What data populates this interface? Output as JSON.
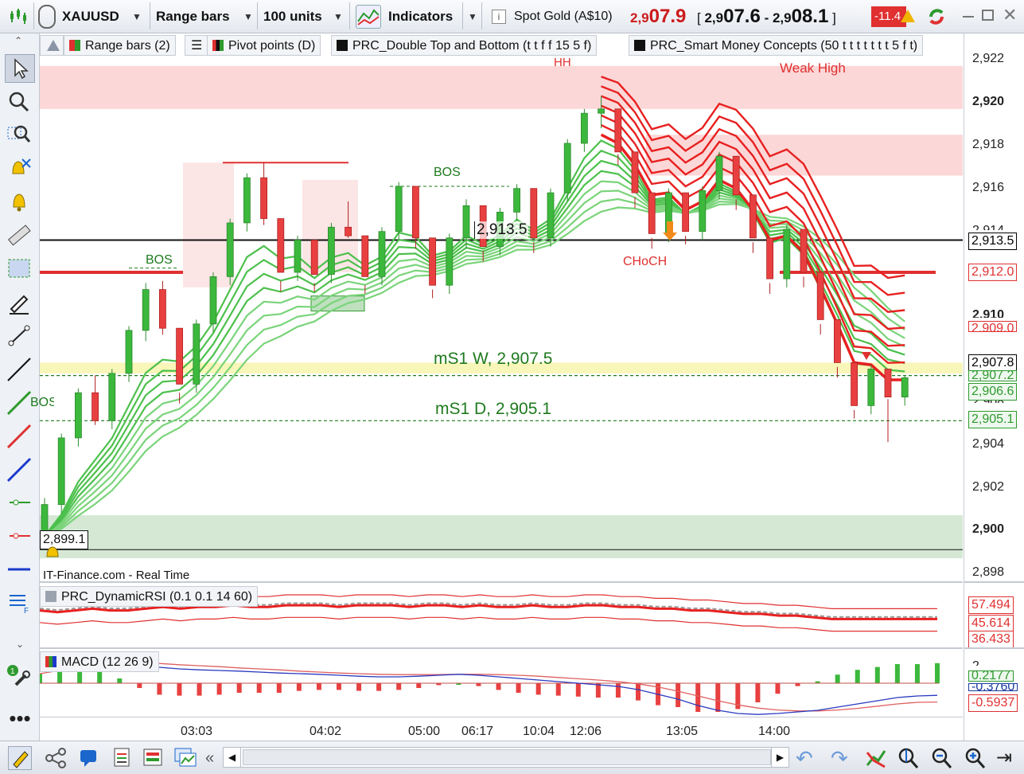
{
  "toolbar": {
    "symbol": "XAUUSD",
    "bar_type": "Range bars",
    "units": "100 units",
    "indicators_label": "Indicators",
    "instrument_name": "Spot Gold (A$10)",
    "last_prefix": "2,9",
    "last_main": "07.9",
    "bid_prefix": "2,9",
    "bid_main": "07.6",
    "ask_prefix": "2,9",
    "ask_main": "08.1",
    "bracket_open": "[",
    "bracket_close": "]",
    "dash": "-",
    "change": "-11.4",
    "colors": {
      "up": "#2e9a2e",
      "down": "#e03030",
      "accent": "#1a66cc"
    }
  },
  "legend_main": [
    {
      "label": "Range bars (2)",
      "icon": "range-bars-icon"
    },
    {
      "label": "Pivot points (D)",
      "icon": "pivot-icon"
    },
    {
      "label": "PRC_Double Top and Bottom (t t f f 15 5 f)",
      "icon": "black-square-icon"
    },
    {
      "label": "PRC_Smart Money Concepts (50 t t t t t t t 5 f t)",
      "icon": "black-square-icon"
    }
  ],
  "annotations": {
    "hh": "HH",
    "weak_high": "Weak High",
    "bos1": "BOS",
    "bos2": "BOS",
    "bos3": "BOS",
    "choch": "CHoCH",
    "ms1w": "mS1 W, 2,907.5",
    "ms1d": "mS1 D, 2,905.1",
    "level_2913": "2,913.5",
    "level_2899": "2,899.1",
    "source": "IT-Finance.com - Real Time"
  },
  "price_axis": {
    "ticks": [
      "2,922",
      "2,920",
      "2,918",
      "2,916",
      "2,914",
      "2,910",
      "2,908",
      "2,906",
      "2,904",
      "2,902",
      "2,900",
      "2,898"
    ],
    "boxes": [
      {
        "label": "2,913.5",
        "color": "#000000"
      },
      {
        "label": "2,912.0",
        "color": "#e03030"
      },
      {
        "label": "2,909.0",
        "color": "#e03030"
      },
      {
        "label": "2,907.8",
        "color": "#000000"
      },
      {
        "label": "2,907.2",
        "color": "#2e9a2e"
      },
      {
        "label": "2,906.6",
        "color": "#2e9a2e"
      },
      {
        "label": "2,905.1",
        "color": "#2e9a2e"
      }
    ]
  },
  "rsi_panel": {
    "legend": "PRC_DynamicRSI (0.1 0.1 14 60)",
    "ticks": [
      {
        "label": "57.494",
        "color": "#e03030"
      },
      {
        "label": "45.614",
        "color": "#e03030"
      },
      {
        "label": "36.433",
        "color": "#e03030"
      }
    ]
  },
  "macd_panel": {
    "legend": "MACD (12 26 9)",
    "ticks": [
      {
        "label": "0.2177",
        "color": "#2e9a2e"
      },
      {
        "label": "-0.3760",
        "color": "#1a3aa0"
      },
      {
        "label": "-0.5937",
        "color": "#e03030"
      },
      {
        "label": "2",
        "color": "#222222"
      }
    ]
  },
  "time_axis": [
    "03:03",
    "04:02",
    "05:00",
    "06:17",
    "10:04",
    "12:06",
    "13:05",
    "14:00"
  ],
  "chart_data": {
    "type": "candlestick",
    "title": "XAUUSD Range bars",
    "ylim": [
      2897.5,
      2922.5
    ],
    "candle_ohlc": [
      [
        2899.5,
        2901.5,
        2899.1,
        2901.2
      ],
      [
        2901.2,
        2904.5,
        2900.8,
        2904.3
      ],
      [
        2904.3,
        2906.6,
        2903.9,
        2906.4
      ],
      [
        2906.4,
        2907.2,
        2904.9,
        2905.1
      ],
      [
        2905.1,
        2907.5,
        2904.7,
        2907.3
      ],
      [
        2907.3,
        2909.5,
        2906.9,
        2909.3
      ],
      [
        2909.3,
        2911.5,
        2908.8,
        2911.2
      ],
      [
        2911.2,
        2911.6,
        2909.1,
        2909.4
      ],
      [
        2909.4,
        2906.4,
        2905.9,
        2906.8
      ],
      [
        2906.8,
        2909.8,
        2906.4,
        2909.6
      ],
      [
        2909.6,
        2912.0,
        2909.2,
        2911.8
      ],
      [
        2911.8,
        2914.5,
        2911.4,
        2914.3
      ],
      [
        2914.3,
        2916.6,
        2913.9,
        2916.4
      ],
      [
        2916.4,
        2917.1,
        2914.2,
        2914.5
      ],
      [
        2914.5,
        2911.6,
        2911.1,
        2912.0
      ],
      [
        2912.0,
        2913.7,
        2911.6,
        2913.5
      ],
      [
        2913.5,
        2911.5,
        2911.1,
        2911.9
      ],
      [
        2911.9,
        2914.3,
        2911.5,
        2914.1
      ],
      [
        2914.1,
        2915.3,
        2913.6,
        2913.7
      ],
      [
        2913.7,
        2911.4,
        2911.0,
        2911.8
      ],
      [
        2911.8,
        2914.1,
        2911.4,
        2913.9
      ],
      [
        2913.9,
        2916.2,
        2913.5,
        2916.0
      ],
      [
        2916.0,
        2913.6,
        2913.1,
        2913.6
      ],
      [
        2913.6,
        2911.2,
        2910.8,
        2911.4
      ],
      [
        2911.4,
        2913.8,
        2911.0,
        2913.6
      ],
      [
        2913.6,
        2915.4,
        2913.1,
        2915.1
      ],
      [
        2915.1,
        2913.0,
        2912.5,
        2913.2
      ],
      [
        2913.2,
        2915.0,
        2912.8,
        2914.8
      ],
      [
        2914.8,
        2916.1,
        2914.4,
        2915.9
      ],
      [
        2915.9,
        2913.4,
        2912.9,
        2913.6
      ],
      [
        2913.6,
        2915.9,
        2913.2,
        2915.7
      ],
      [
        2915.7,
        2918.2,
        2915.3,
        2918.0
      ],
      [
        2918.0,
        2919.6,
        2917.6,
        2919.4
      ],
      [
        2919.4,
        2920.2,
        2918.7,
        2919.6
      ],
      [
        2919.6,
        2917.5,
        2917.0,
        2917.6
      ],
      [
        2917.6,
        2915.5,
        2915.0,
        2915.7
      ],
      [
        2915.7,
        2913.6,
        2913.1,
        2913.8
      ],
      [
        2913.8,
        2915.9,
        2913.4,
        2915.7
      ],
      [
        2915.7,
        2913.7,
        2913.3,
        2913.9
      ],
      [
        2913.9,
        2916.0,
        2913.5,
        2915.8
      ],
      [
        2915.8,
        2917.6,
        2915.4,
        2917.4
      ],
      [
        2917.4,
        2915.4,
        2914.9,
        2915.6
      ],
      [
        2915.6,
        2913.4,
        2912.9,
        2913.6
      ],
      [
        2913.6,
        2911.5,
        2911.0,
        2911.7
      ],
      [
        2911.7,
        2914.2,
        2911.3,
        2914.0
      ],
      [
        2914.0,
        2911.8,
        2911.3,
        2912.0
      ],
      [
        2912.0,
        2909.6,
        2909.1,
        2909.8
      ],
      [
        2909.8,
        2907.6,
        2907.1,
        2907.8
      ],
      [
        2907.8,
        2905.6,
        2905.2,
        2905.8
      ],
      [
        2905.8,
        2907.7,
        2905.4,
        2907.5
      ],
      [
        2907.5,
        2906.1,
        2904.1,
        2906.2
      ],
      [
        2906.2,
        2907.2,
        2905.8,
        2907.1
      ]
    ],
    "series": [
      {
        "name": "fast-ema-ribbon",
        "values": [
          2900.5,
          2901.5,
          2903.0,
          2904.0,
          2905.0,
          2906.5,
          2908.0,
          2908.6,
          2908.5,
          2909.2,
          2910.3,
          2911.8,
          2913.3,
          2913.8,
          2913.2,
          2913.3,
          2912.6,
          2913.2,
          2913.4,
          2912.8,
          2913.2,
          2914.3,
          2914.1,
          2913.2,
          2913.4,
          2914.1,
          2913.7,
          2914.1,
          2914.8,
          2914.3,
          2914.8,
          2916.2,
          2917.6,
          2918.4,
          2918.0,
          2917.0,
          2915.6,
          2915.7,
          2914.9,
          2915.3,
          2916.3,
          2915.9,
          2914.9,
          2913.5,
          2913.7,
          2912.9,
          2911.3,
          2909.6,
          2907.8,
          2907.7,
          2907.0,
          2907.0
        ]
      },
      {
        "name": "slow-ema-ribbon",
        "values": [
          2898.6,
          2899.0,
          2899.5,
          2900.0,
          2900.6,
          2901.4,
          2902.3,
          2903.0,
          2903.5,
          2904.1,
          2904.8,
          2905.6,
          2906.5,
          2907.3,
          2907.8,
          2908.3,
          2908.7,
          2909.2,
          2909.6,
          2909.9,
          2910.2,
          2910.6,
          2911.0,
          2911.2,
          2911.4,
          2911.7,
          2911.9,
          2912.1,
          2912.4,
          2912.5,
          2912.7,
          2913.1,
          2913.6,
          2914.0,
          2914.3,
          2914.4,
          2914.4,
          2914.5,
          2914.5,
          2914.6,
          2914.8,
          2914.9,
          2914.8,
          2914.6,
          2914.5,
          2914.2,
          2913.8,
          2913.2,
          2912.4,
          2911.6,
          2910.8,
          2910.1
        ]
      }
    ],
    "rsi": {
      "ylim": [
        30,
        65
      ],
      "values": [
        50,
        49,
        50,
        51,
        50,
        50,
        51,
        52,
        51,
        52,
        52,
        53,
        52,
        52,
        53,
        53,
        53,
        52,
        53,
        53,
        53,
        52,
        53,
        53,
        52,
        53,
        52,
        52,
        53,
        52,
        52,
        53,
        53,
        52,
        52,
        51,
        51,
        50,
        50,
        49,
        48,
        48,
        47,
        47,
        46,
        45,
        45,
        45,
        45,
        45,
        45,
        45
      ],
      "upper": 57.494,
      "mid": 45.614,
      "lower": 36.433
    },
    "macd": {
      "ylim": [
        -1.0,
        1.0
      ],
      "macd": [
        0.4,
        0.55,
        0.7,
        0.75,
        0.7,
        0.6,
        0.5,
        0.45,
        0.42,
        0.4,
        0.38,
        0.35,
        0.32,
        0.3,
        0.28,
        0.25,
        0.22,
        0.2,
        0.2,
        0.22,
        0.25,
        0.28,
        0.25,
        0.2,
        0.15,
        0.1,
        0.05,
        0.0,
        -0.05,
        -0.1,
        -0.2,
        -0.35,
        -0.5,
        -0.7,
        -0.85,
        -0.95,
        -0.98,
        -0.95,
        -0.9,
        -0.85,
        -0.75,
        -0.65,
        -0.55,
        -0.45,
        -0.4,
        -0.38
      ],
      "signal": [
        0.3,
        0.4,
        0.5,
        0.6,
        0.65,
        0.65,
        0.62,
        0.58,
        0.55,
        0.52,
        0.48,
        0.45,
        0.42,
        0.38,
        0.35,
        0.32,
        0.3,
        0.28,
        0.27,
        0.27,
        0.27,
        0.28,
        0.28,
        0.27,
        0.25,
        0.22,
        0.18,
        0.14,
        0.1,
        0.05,
        -0.02,
        -0.12,
        -0.25,
        -0.4,
        -0.55,
        -0.68,
        -0.78,
        -0.84,
        -0.87,
        -0.87,
        -0.84,
        -0.79,
        -0.72,
        -0.65,
        -0.6,
        -0.59
      ]
    }
  }
}
